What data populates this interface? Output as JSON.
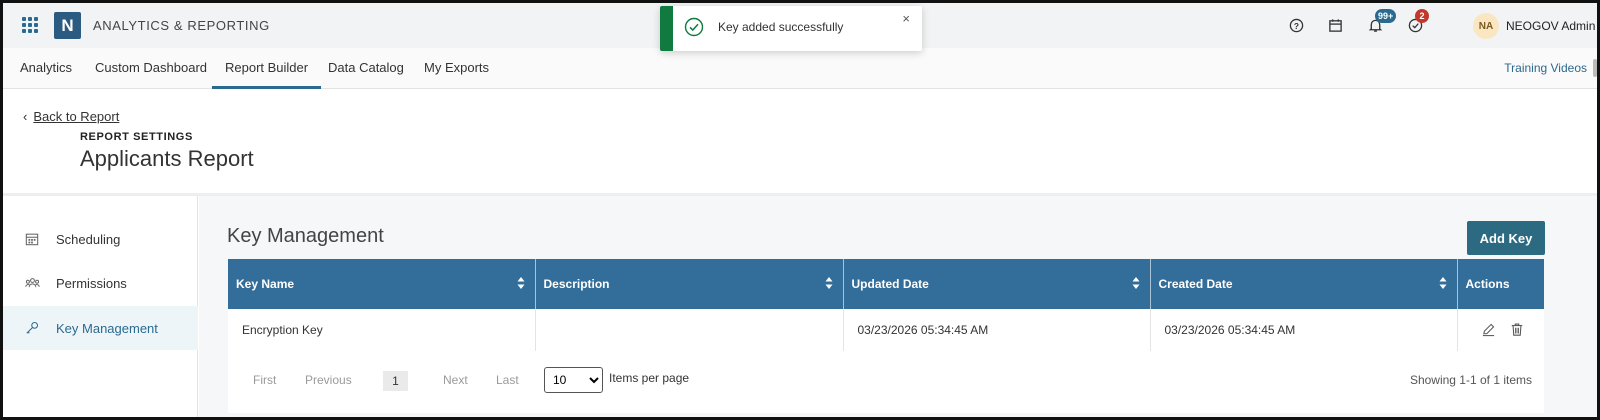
{
  "header": {
    "logo_letter": "N",
    "app_title": "ANALYTICS & REPORTING",
    "notifications_badge": "99+",
    "tasks_badge": "2",
    "avatar_initials": "NA",
    "user_name": "NEOGOV Admin"
  },
  "nav": {
    "tabs": [
      {
        "label": "Analytics"
      },
      {
        "label": "Custom Dashboard"
      },
      {
        "label": "Report Builder",
        "active": true
      },
      {
        "label": "Data Catalog"
      },
      {
        "label": "My Exports"
      }
    ],
    "training_link": "Training Videos"
  },
  "toast": {
    "message": "Key added successfully",
    "close": "×"
  },
  "report": {
    "back_label": "Back to Report",
    "caption": "REPORT SETTINGS",
    "title": "Applicants Report"
  },
  "sidemenu": {
    "items": [
      {
        "label": "Scheduling",
        "icon": "calendar-icon"
      },
      {
        "label": "Permissions",
        "icon": "users-icon"
      },
      {
        "label": "Key Management",
        "icon": "key-icon",
        "active": true
      }
    ]
  },
  "main": {
    "section_title": "Key Management",
    "add_key_label": "Add Key",
    "columns": [
      "Key Name",
      "Description",
      "Updated Date",
      "Created Date",
      "Actions"
    ],
    "rows": [
      {
        "key_name": "Encryption Key",
        "description": "",
        "updated_date": "03/23/2026 05:34:45 AM",
        "created_date": "03/23/2026 05:34:45 AM"
      }
    ],
    "pager": {
      "first": "First",
      "previous": "Previous",
      "current_page": "1",
      "next": "Next",
      "last": "Last",
      "per_page_value": "10",
      "per_page_label": "Items per page",
      "showing": "Showing 1-1 of 1 items"
    }
  },
  "colors": {
    "accent": "#2b6a8f",
    "table_header": "#336e9b",
    "toast_success": "#107a3f",
    "badge_red": "#c0392b"
  }
}
